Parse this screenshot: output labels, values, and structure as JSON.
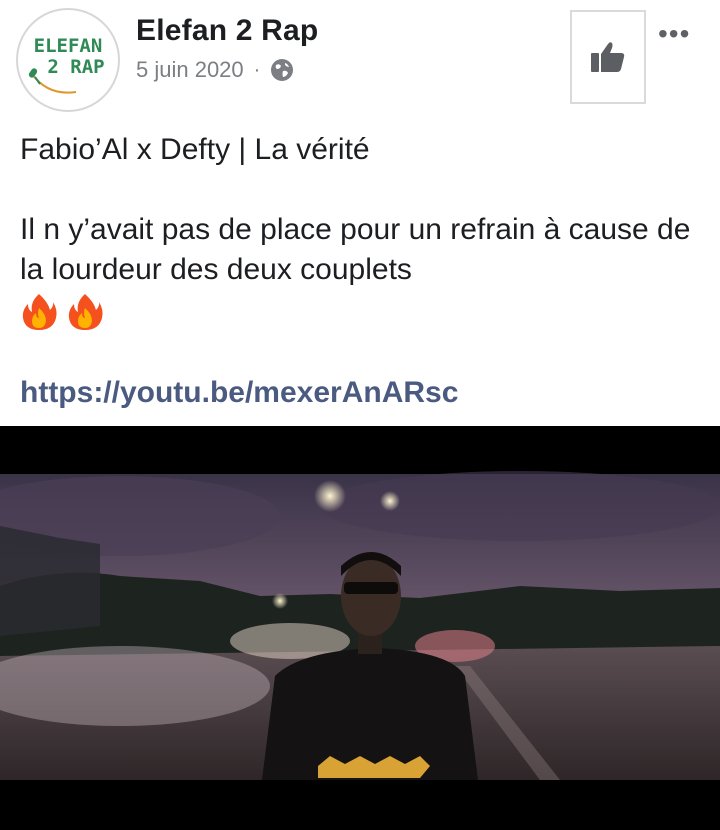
{
  "post": {
    "page_name": "Elefan 2 Rap",
    "date": "5 juin 2020",
    "separator": "·",
    "privacy_icon": "globe-icon",
    "more_label": "•••",
    "title": "Fabio’Al x Defty | La vérité",
    "body": "Il n y’avait pas de place pour un refrain à cause de la lourdeur des deux couplets",
    "emojis": [
      "🔥",
      "🔥"
    ],
    "link": "https://youtu.be/mexerAnARsc"
  },
  "avatar": {
    "line1": "ELEFAN",
    "line2": "2 RAP"
  },
  "colors": {
    "text": "#1c1e21",
    "meta": "#7b7e83",
    "link": "#4a5a80",
    "logo_green": "#2f8a55"
  }
}
